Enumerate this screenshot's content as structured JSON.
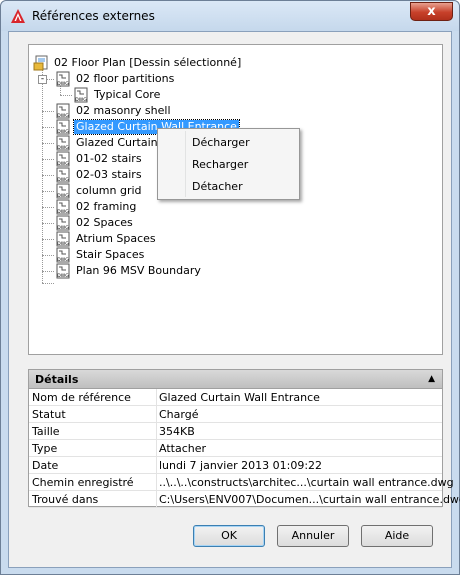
{
  "window": {
    "title": "Références externes",
    "close_label": "x"
  },
  "tree": {
    "root_label": "02 Floor Plan [Dessin sélectionné]",
    "expander_label": "-",
    "icon_text": "DWG",
    "items": [
      {
        "label": "02 floor partitions"
      },
      {
        "label": "Typical Core"
      },
      {
        "label": "02 masonry shell"
      },
      {
        "label": "Glazed Curtain Wall Entrance",
        "selected": true
      },
      {
        "label": "Glazed Curtain Wa"
      },
      {
        "label": "01-02 stairs"
      },
      {
        "label": "02-03 stairs"
      },
      {
        "label": "column grid"
      },
      {
        "label": "02 framing"
      },
      {
        "label": "02 Spaces"
      },
      {
        "label": "Atrium Spaces"
      },
      {
        "label": "Stair Spaces"
      },
      {
        "label": "Plan 96 MSV Boundary"
      }
    ]
  },
  "context_menu": {
    "items": [
      {
        "label": "Décharger"
      },
      {
        "label": "Recharger"
      },
      {
        "label": "Détacher"
      }
    ]
  },
  "details": {
    "title": "Détails",
    "collapse_glyph": "▲",
    "rows": [
      {
        "key": "Nom de référence",
        "value": "Glazed Curtain Wall Entrance"
      },
      {
        "key": "Statut",
        "value": "Chargé"
      },
      {
        "key": "Taille",
        "value": "354KB"
      },
      {
        "key": "Type",
        "value": "Attacher"
      },
      {
        "key": "Date",
        "value": "lundi 7 janvier 2013  01:09:22"
      },
      {
        "key": "Chemin enregistré",
        "value": "..\\..\\..\\constructs\\architec...\\curtain wall entrance.dwg"
      },
      {
        "key": "Trouvé dans",
        "value": "C:\\Users\\ENV007\\Documen...\\curtain wall entrance.dwg"
      }
    ]
  },
  "buttons": {
    "ok": "OK",
    "cancel": "Annuler",
    "help": "Aide"
  },
  "colors": {
    "selection": "#3399ff",
    "close_button": "#c7402a",
    "frame": "#c9dbee"
  }
}
